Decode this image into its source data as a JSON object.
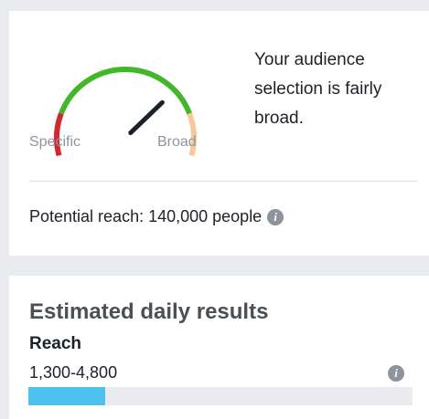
{
  "audience": {
    "gauge_label_specific": "Specific",
    "gauge_label_broad": "Broad",
    "gauge_level": 0.72,
    "description": "Your audience selection is fairly broad.",
    "potential_reach": "Potential reach: 140,000 people",
    "colors": {
      "specific": "#d0282e",
      "middle": "#42b72a",
      "broad": "#f7c89a",
      "needle": "#1d2129"
    }
  },
  "results": {
    "title": "Estimated daily results",
    "reach_label": "Reach",
    "reach_range": "1,300-4,800",
    "reach_fill_fraction": 0.2,
    "bar_color": "#4cc2ec"
  },
  "icons": {
    "info": "info-icon",
    "info_glyph": "i"
  }
}
